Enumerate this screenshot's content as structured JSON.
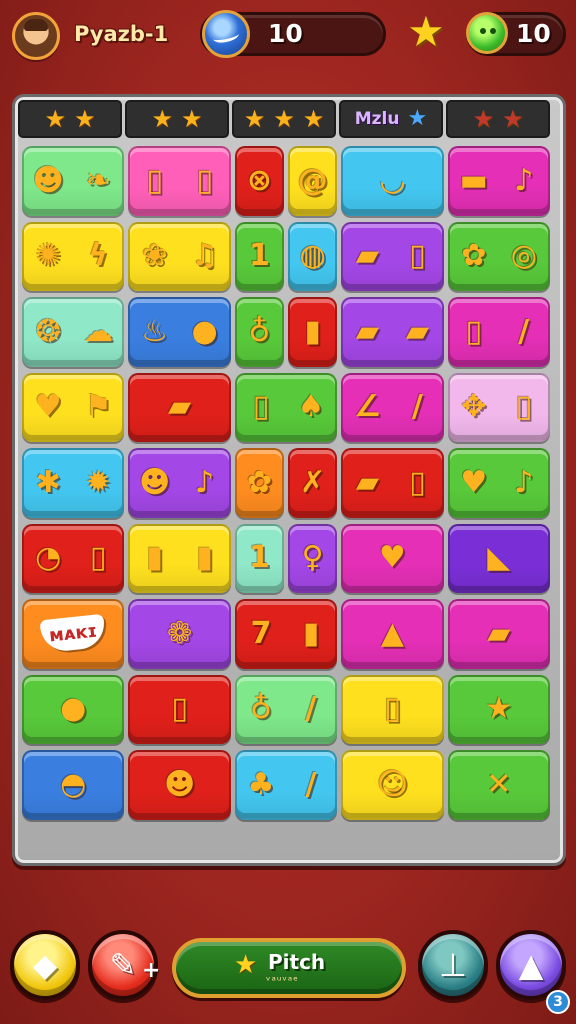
{
  "header": {
    "player_name": "Pyazb-1",
    "coins": "10",
    "gems": "10",
    "coin_icon": "coin-icon",
    "gem_icon": "green-gem-icon",
    "star_icon": "star-icon"
  },
  "level_strip": [
    {
      "stars": 2,
      "label": "",
      "color": "#f7b21d"
    },
    {
      "stars": 2,
      "label": "",
      "color": "#f7b21d"
    },
    {
      "stars": 3,
      "label": "",
      "color": "#f7b21d"
    },
    {
      "stars": 0,
      "label": "Mzlu",
      "color": "#4aa9ff"
    },
    {
      "stars": 2,
      "label": "",
      "color": "#c0392b"
    }
  ],
  "board": {
    "rows": [
      [
        {
          "span": 2,
          "color": "#7ee88a",
          "icons": [
            "☻",
            "❧"
          ]
        },
        {
          "span": 2,
          "color": "#ff5fb8",
          "icons": [
            "▯",
            "▯"
          ]
        },
        {
          "span": 1,
          "color": "#e0201a",
          "icons": [
            "⊗"
          ]
        },
        {
          "span": 1,
          "color": "#ffe01f",
          "icons": [
            "@"
          ]
        },
        {
          "span": 2,
          "color": "#43c7f0",
          "icons": [
            "◡"
          ]
        },
        {
          "span": 2,
          "color": "#e42fb6",
          "icons": [
            "▬",
            "♪"
          ]
        }
      ],
      [
        {
          "span": 2,
          "color": "#ffe01f",
          "icons": [
            "✺",
            "ϟ"
          ]
        },
        {
          "span": 2,
          "color": "#ffe01f",
          "icons": [
            "❀",
            "♫"
          ]
        },
        {
          "span": 1,
          "color": "#58c93a",
          "icons": [
            "1"
          ]
        },
        {
          "span": 1,
          "color": "#43c7f0",
          "icons": [
            "◍"
          ]
        },
        {
          "span": 2,
          "color": "#a347e6",
          "icons": [
            "▰",
            "▯"
          ]
        },
        {
          "span": 2,
          "color": "#58c93a",
          "icons": [
            "✿",
            "◎"
          ]
        }
      ],
      [
        {
          "span": 2,
          "color": "#8fe8c8",
          "icons": [
            "❂",
            "☁"
          ]
        },
        {
          "span": 2,
          "color": "#3a7fe0",
          "icons": [
            "♨",
            "●"
          ]
        },
        {
          "span": 1,
          "color": "#58c93a",
          "icons": [
            "♁"
          ]
        },
        {
          "span": 1,
          "color": "#e0201a",
          "icons": [
            "▮"
          ]
        },
        {
          "span": 2,
          "color": "#a347e6",
          "icons": [
            "▰",
            "▰"
          ]
        },
        {
          "span": 2,
          "color": "#e42fb6",
          "icons": [
            "▯",
            "/"
          ]
        }
      ],
      [
        {
          "span": 2,
          "color": "#ffe01f",
          "icons": [
            "♥",
            "⚑"
          ]
        },
        {
          "span": 2,
          "color": "#e0201a",
          "icons": [
            "▰"
          ]
        },
        {
          "span": 2,
          "color": "#58c93a",
          "icons": [
            "▯",
            "♠"
          ]
        },
        {
          "span": 2,
          "color": "#e42fb6",
          "icons": [
            "∠",
            "/"
          ]
        },
        {
          "span": 2,
          "color": "#f2b8ec",
          "icons": [
            "✥",
            "▯"
          ]
        }
      ],
      [
        {
          "span": 2,
          "color": "#43c7f0",
          "icons": [
            "✱",
            "✹"
          ]
        },
        {
          "span": 2,
          "color": "#a347e6",
          "icons": [
            "☻",
            "♪"
          ]
        },
        {
          "span": 1,
          "color": "#ff8c1f",
          "icons": [
            "✿"
          ]
        },
        {
          "span": 1,
          "color": "#e0201a",
          "icons": [
            "✗"
          ]
        },
        {
          "span": 2,
          "color": "#e0201a",
          "icons": [
            "▰",
            "▯"
          ]
        },
        {
          "span": 2,
          "color": "#58c93a",
          "icons": [
            "♥",
            "♪"
          ]
        }
      ],
      [
        {
          "span": 2,
          "color": "#e0201a",
          "icons": [
            "◔",
            "▯"
          ]
        },
        {
          "span": 2,
          "color": "#ffe01f",
          "icons": [
            "▮",
            "▮"
          ]
        },
        {
          "span": 1,
          "color": "#8fe8c8",
          "icons": [
            "1"
          ]
        },
        {
          "span": 1,
          "color": "#a347e6",
          "icons": [
            "♀"
          ]
        },
        {
          "span": 2,
          "color": "#e42fb6",
          "icons": [
            "♥"
          ]
        },
        {
          "span": 2,
          "color": "#7a2fd6",
          "icons": [
            "◣"
          ]
        }
      ],
      [
        {
          "span": 2,
          "color": "#ff8c1f",
          "text": "ᴍᴀᴋɪ"
        },
        {
          "span": 2,
          "color": "#a347e6",
          "icons": [
            "❁"
          ]
        },
        {
          "span": 2,
          "color": "#e0201a",
          "icons": [
            "7",
            "▮"
          ]
        },
        {
          "span": 2,
          "color": "#e42fb6",
          "icons": [
            "▲"
          ]
        },
        {
          "span": 2,
          "color": "#e42fb6",
          "icons": [
            "▰"
          ]
        }
      ],
      [
        {
          "span": 2,
          "color": "#58c93a",
          "icons": [
            "●"
          ]
        },
        {
          "span": 2,
          "color": "#e0201a",
          "icons": [
            "▯"
          ]
        },
        {
          "span": 2,
          "color": "#7ee88a",
          "icons": [
            "♁",
            "/"
          ]
        },
        {
          "span": 2,
          "color": "#ffe01f",
          "icons": [
            "▯"
          ]
        },
        {
          "span": 2,
          "color": "#58c93a",
          "icons": [
            "★"
          ]
        }
      ],
      [
        {
          "span": 2,
          "color": "#3a7fe0",
          "icons": [
            "◓"
          ]
        },
        {
          "span": 2,
          "color": "#e0201a",
          "icons": [
            "☻"
          ]
        },
        {
          "span": 2,
          "color": "#43c7f0",
          "icons": [
            "♣",
            "/"
          ]
        },
        {
          "span": 2,
          "color": "#ffe01f",
          "icons": [
            "☺"
          ]
        },
        {
          "span": 2,
          "color": "#58c93a",
          "icons": [
            "✕"
          ]
        }
      ]
    ]
  },
  "bottom_bar": {
    "left_button_icon": "eraser-icon",
    "left_button_glyph": "◆",
    "hammer_button_icon": "hammer-icon",
    "hammer_button_glyph": "✎",
    "hammer_plus": "+",
    "pitch_label": "Pitch",
    "pitch_sub": "ᵛᵃᵘᵛᵃᵉ",
    "shovel_button_icon": "shovel-icon",
    "shovel_button_glyph": "⊥",
    "wizard_button_icon": "wizard-hat-icon",
    "wizard_button_glyph": "▲",
    "corner_badge": "3"
  }
}
